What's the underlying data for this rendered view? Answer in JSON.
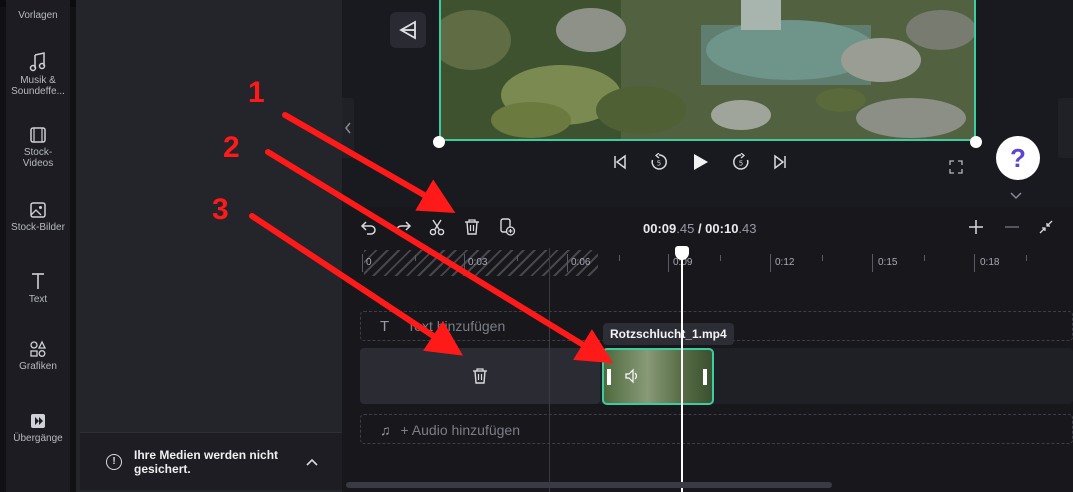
{
  "sidebar": {
    "items": [
      {
        "label": "Vorlagen",
        "icon": "templates-icon"
      },
      {
        "label": "Musik & Soundeffe...",
        "icon": "music-note-icon"
      },
      {
        "label": "Stock-Videos",
        "icon": "film-icon"
      },
      {
        "label": "Stock-Bilder",
        "icon": "image-icon"
      },
      {
        "label": "Text",
        "icon": "text-icon"
      },
      {
        "label": "Grafiken",
        "icon": "shapes-icon"
      },
      {
        "label": "Übergänge",
        "icon": "transition-icon"
      }
    ]
  },
  "media_panel": {
    "toast_text": "Ihre Medien werden nicht gesichert."
  },
  "player": {
    "help_label": "?"
  },
  "timeline": {
    "current_time_main": "00:09",
    "current_time_frac": ".45",
    "separator": " / ",
    "total_time_main": "00:10",
    "total_time_frac": ".43",
    "ticks": [
      "0",
      "0:03",
      "0:06",
      "0:09",
      "0:12",
      "0:15",
      "0:18"
    ],
    "text_track_label": "Text hinzufügen",
    "audio_track_label": "+ Audio hinzufügen",
    "clip_name": "Rotzschlucht_1.mp4"
  },
  "annotations": {
    "labels": [
      "1",
      "2",
      "3"
    ],
    "color": "#ff1a1a"
  },
  "colors": {
    "accent": "#3dcca0",
    "help": "#5b45d6"
  }
}
